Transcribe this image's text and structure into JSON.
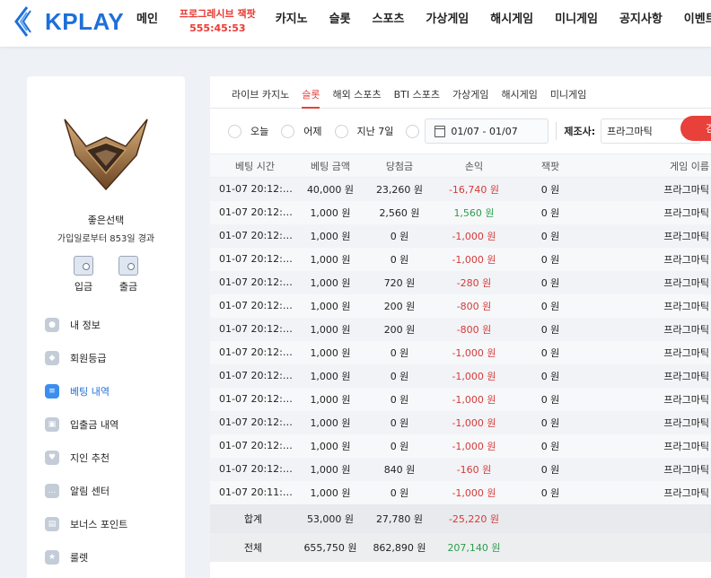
{
  "header": {
    "logo_text": "KPLAY",
    "nav": [
      {
        "label": "메인"
      },
      {
        "label_line1": "프로그레시브 잭팟",
        "label_line2": "555:45:53",
        "promo": true
      },
      {
        "label": "카지노"
      },
      {
        "label": "슬롯"
      },
      {
        "label": "스포츠"
      },
      {
        "label": "가상게임"
      },
      {
        "label": "해시게임"
      },
      {
        "label": "미니게임"
      },
      {
        "label": "공지사항"
      },
      {
        "label": "이벤트"
      }
    ]
  },
  "sidebar": {
    "user_name": "좋은선택",
    "user_sub": "가입일로부터 853일 경과",
    "deposit_label": "입금",
    "withdraw_label": "출금",
    "menu": [
      {
        "label": "내 정보",
        "icon": "profile-icon"
      },
      {
        "label": "회원등급",
        "icon": "grade-icon"
      },
      {
        "label": "베팅 내역",
        "icon": "betting-history-icon",
        "active": true
      },
      {
        "label": "입출금 내역",
        "icon": "transaction-icon"
      },
      {
        "label": "지인 추천",
        "icon": "referral-icon"
      },
      {
        "label": "알림 센터",
        "icon": "notification-icon"
      },
      {
        "label": "보너스 포인트",
        "icon": "bonus-icon"
      },
      {
        "label": "룰렛",
        "icon": "roulette-icon"
      }
    ]
  },
  "tabs": [
    {
      "label": "라이브 카지노"
    },
    {
      "label": "슬롯",
      "active": true
    },
    {
      "label": "해외 스포츠"
    },
    {
      "label": "BTI 스포츠"
    },
    {
      "label": "가상게임"
    },
    {
      "label": "해시게임"
    },
    {
      "label": "미니게임"
    }
  ],
  "filters": {
    "today": "오늘",
    "yesterday": "어제",
    "last7": "지난 7일",
    "date_range": "01/07 - 01/07",
    "provider_label": "제조사:",
    "provider_value": "프라그마틱",
    "search_label": "검"
  },
  "table": {
    "headers": [
      "베팅 시간",
      "베팅 금액",
      "당첨금",
      "손익",
      "잭팟",
      "게임 이름"
    ],
    "rows": [
      {
        "time": "01-07 20:12:…",
        "bet": "40,000 원",
        "win": "23,260 원",
        "pl": "-16,740 원",
        "jp": "0 원",
        "game": "프라그마틱"
      },
      {
        "time": "01-07 20:12:…",
        "bet": "1,000 원",
        "win": "2,560 원",
        "pl": "1,560 원",
        "jp": "0 원",
        "game": "프라그마틱"
      },
      {
        "time": "01-07 20:12:…",
        "bet": "1,000 원",
        "win": "0 원",
        "pl": "-1,000 원",
        "jp": "0 원",
        "game": "프라그마틱"
      },
      {
        "time": "01-07 20:12:…",
        "bet": "1,000 원",
        "win": "0 원",
        "pl": "-1,000 원",
        "jp": "0 원",
        "game": "프라그마틱"
      },
      {
        "time": "01-07 20:12:…",
        "bet": "1,000 원",
        "win": "720 원",
        "pl": "-280 원",
        "jp": "0 원",
        "game": "프라그마틱"
      },
      {
        "time": "01-07 20:12:…",
        "bet": "1,000 원",
        "win": "200 원",
        "pl": "-800 원",
        "jp": "0 원",
        "game": "프라그마틱"
      },
      {
        "time": "01-07 20:12:…",
        "bet": "1,000 원",
        "win": "200 원",
        "pl": "-800 원",
        "jp": "0 원",
        "game": "프라그마틱"
      },
      {
        "time": "01-07 20:12:…",
        "bet": "1,000 원",
        "win": "0 원",
        "pl": "-1,000 원",
        "jp": "0 원",
        "game": "프라그마틱"
      },
      {
        "time": "01-07 20:12:…",
        "bet": "1,000 원",
        "win": "0 원",
        "pl": "-1,000 원",
        "jp": "0 원",
        "game": "프라그마틱"
      },
      {
        "time": "01-07 20:12:…",
        "bet": "1,000 원",
        "win": "0 원",
        "pl": "-1,000 원",
        "jp": "0 원",
        "game": "프라그마틱"
      },
      {
        "time": "01-07 20:12:…",
        "bet": "1,000 원",
        "win": "0 원",
        "pl": "-1,000 원",
        "jp": "0 원",
        "game": "프라그마틱"
      },
      {
        "time": "01-07 20:12:…",
        "bet": "1,000 원",
        "win": "0 원",
        "pl": "-1,000 원",
        "jp": "0 원",
        "game": "프라그마틱"
      },
      {
        "time": "01-07 20:12:…",
        "bet": "1,000 원",
        "win": "840 원",
        "pl": "-160 원",
        "jp": "0 원",
        "game": "프라그마틱"
      },
      {
        "time": "01-07 20:11:…",
        "bet": "1,000 원",
        "win": "0 원",
        "pl": "-1,000 원",
        "jp": "0 원",
        "game": "프라그마틱"
      }
    ],
    "subtotal": {
      "label": "합계",
      "bet": "53,000 원",
      "win": "27,780 원",
      "pl": "-25,220 원"
    },
    "total": {
      "label": "전체",
      "bet": "655,750 원",
      "win": "862,890 원",
      "pl": "207,140 원"
    }
  },
  "colors": {
    "brand": "#1e6fd9",
    "accent": "#e8403a",
    "loss": "#d23b3b",
    "gain": "#2a9d4b"
  }
}
